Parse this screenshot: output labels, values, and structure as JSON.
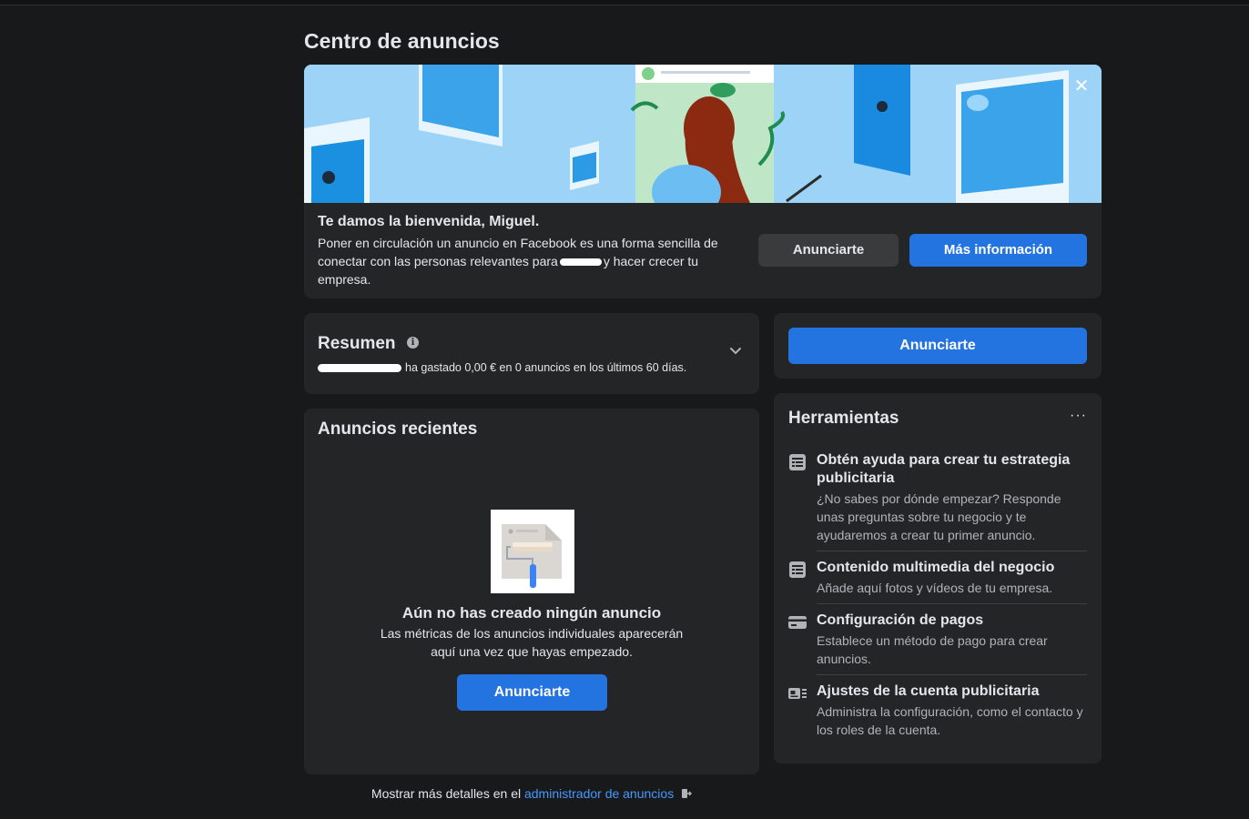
{
  "page": {
    "title": "Centro de anuncios"
  },
  "banner": {
    "close_glyph": "✕",
    "welcome_title": "Te damos la bienvenida, Miguel.",
    "body_part1": "Poner en circulación un anuncio en Facebook es una forma sencilla de conectar con las personas relevantes para",
    "body_part2": "y hacer crecer tu empresa.",
    "advertise_label": "Anunciarte",
    "more_info_label": "Más información"
  },
  "summary": {
    "title": "Resumen",
    "info_glyph": "i",
    "text": "ha gastado 0,00 € en 0 anuncios en los últimos 60 días."
  },
  "recent": {
    "title": "Anuncios recientes",
    "empty_title": "Aún no has creado ningún anuncio",
    "empty_body": "Las métricas de los anuncios individuales aparecerán aquí una vez que hayas empezado.",
    "advertise_label": "Anunciarte"
  },
  "cta": {
    "advertise_label": "Anunciarte"
  },
  "tools": {
    "title": "Herramientas",
    "more_glyph": "···",
    "items": [
      {
        "icon": "document-list-icon",
        "title": "Obtén ayuda para crear tu estrategia publicitaria",
        "desc": "¿No sabes por dónde empezar? Responde unas preguntas sobre tu negocio y te ayudaremos a crear tu primer anuncio."
      },
      {
        "icon": "document-list-icon",
        "title": "Contenido multimedia del negocio",
        "desc": "Añade aquí fotos y vídeos de tu empresa."
      },
      {
        "icon": "credit-card-icon",
        "title": "Configuración de pagos",
        "desc": "Establece un método de pago para crear anuncios."
      },
      {
        "icon": "account-settings-icon",
        "title": "Ajustes de la cuenta publicitaria",
        "desc": "Administra la configuración, como el contacto y los roles de la cuenta."
      }
    ]
  },
  "footer": {
    "prefix": "Mostrar más detalles en el",
    "link": "administrador de anuncios",
    "link_icon": "external-link-icon"
  },
  "colors": {
    "accent": "#2374e1",
    "card": "#242526",
    "background": "#18191a",
    "link": "#4599ff"
  }
}
